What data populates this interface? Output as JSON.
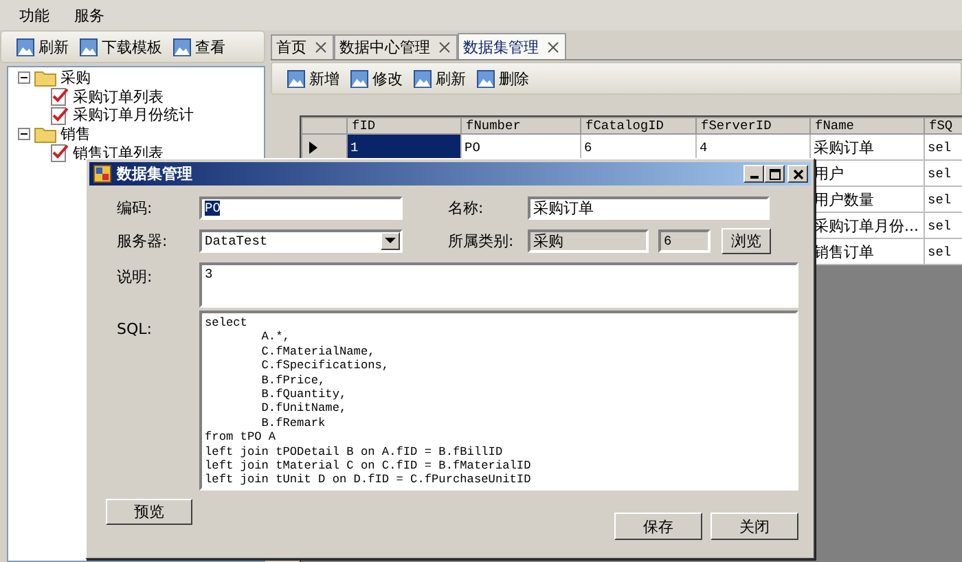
{
  "menu": [
    "功能",
    "服务"
  ],
  "left_toolbar": [
    "刷新",
    "下载模板",
    "查看"
  ],
  "tree": [
    {
      "label": "采购",
      "expanded": true,
      "children": [
        {
          "label": "采购订单列表"
        },
        {
          "label": "采购订单月份统计"
        }
      ]
    },
    {
      "label": "销售",
      "expanded": true,
      "children": [
        {
          "label": "销售订单列表"
        }
      ]
    }
  ],
  "tabs": [
    {
      "label": "首页",
      "selected": false
    },
    {
      "label": "数据中心管理",
      "selected": false
    },
    {
      "label": "数据集管理",
      "selected": true
    }
  ],
  "toolbar": [
    "新增",
    "修改",
    "刷新",
    "删除"
  ],
  "table": {
    "columns": [
      "fID",
      "fNumber",
      "fCatalogID",
      "fServerID",
      "fName",
      "fSQ"
    ],
    "rows": [
      {
        "selected": true,
        "id": "1",
        "number": "PO",
        "catalog_id": "6",
        "server_id": "4",
        "name": "采购订单",
        "sql": "sel"
      },
      {
        "name": "用户",
        "sql": "sel"
      },
      {
        "name": "用户数量",
        "sql": "sel"
      },
      {
        "name": "采购订单月份...",
        "sql": "sel"
      },
      {
        "name": "销售订单",
        "sql": "sel"
      }
    ]
  },
  "dialog": {
    "title": "数据集管理",
    "code": {
      "label": "编码:",
      "value": "PO"
    },
    "name": {
      "label": "名称:",
      "value": "采购订单"
    },
    "server": {
      "label": "服务器:",
      "value": "DataTest"
    },
    "category": {
      "label": "所属类别:",
      "value": "采购",
      "id": "6",
      "button": "浏览"
    },
    "description": {
      "label": "说明:",
      "value": "3"
    },
    "sql": {
      "label": "SQL:",
      "value": "select\n        A.*,\n        C.fMaterialName,\n        C.fSpecifications,\n        B.fPrice,\n        B.fQuantity,\n        D.fUnitName,\n        B.fRemark\nfrom tPO A\nleft join tPODetail B on A.fID = B.fBillID\nleft join tMaterial C on C.fID = B.fMaterialID\nleft join tUnit D on D.fID = C.fPurchaseUnitID"
    },
    "preview_button": "预览",
    "save_button": "保存",
    "close_button": "关闭"
  }
}
